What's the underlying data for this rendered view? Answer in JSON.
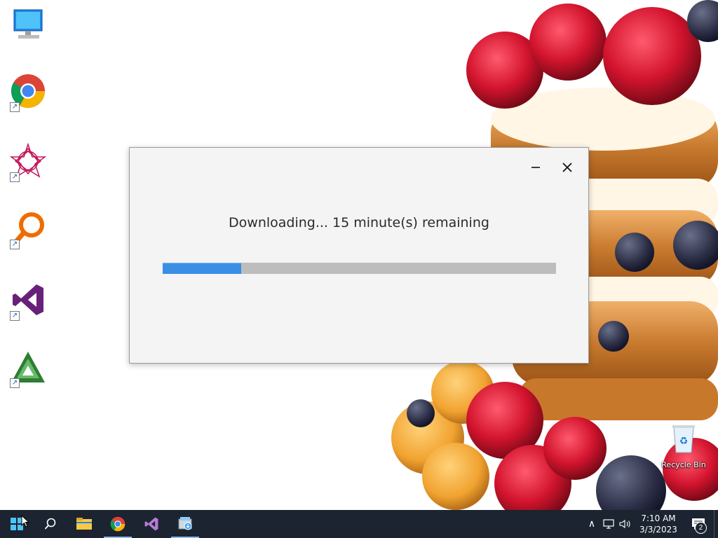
{
  "desktop": {
    "icons": [
      {
        "name": "This PC"
      },
      {
        "name": "Google Chrome"
      },
      {
        "name": "App shortcut"
      },
      {
        "name": "Search app"
      },
      {
        "name": "Visual Studio"
      },
      {
        "name": "Synfig"
      }
    ],
    "recycle_bin": {
      "label": "Recycle Bin"
    }
  },
  "dialog": {
    "status_text": "Downloading... 15 minute(s) remaining",
    "progress_fraction": 0.2,
    "minimize_glyph": "–",
    "close_glyph": "✕"
  },
  "taskbar": {
    "items": [
      {
        "icon": "windows-start-icon"
      },
      {
        "icon": "search-icon"
      },
      {
        "icon": "file-explorer-icon"
      },
      {
        "icon": "chrome-icon"
      },
      {
        "icon": "visual-studio-icon"
      },
      {
        "icon": "installer-icon"
      }
    ],
    "tray": {
      "chevron": "∧",
      "time": "7:10 AM",
      "date": "3/3/2023",
      "notification_count": "2"
    }
  },
  "colors": {
    "progress_fill": "#3a8ee6",
    "progress_track": "#bdbdbd",
    "taskbar_bg": "#1b2430"
  }
}
